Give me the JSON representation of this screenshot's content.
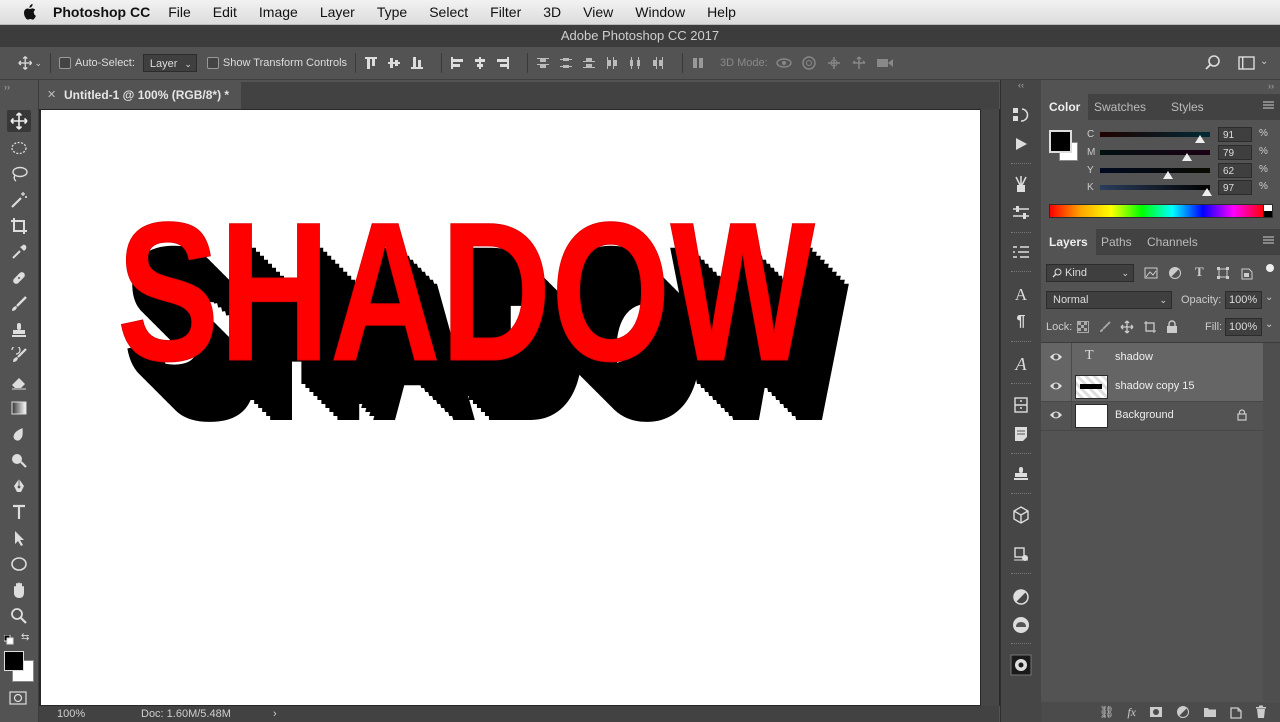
{
  "menubar": {
    "app_name": "Photoshop CC",
    "items": [
      "File",
      "Edit",
      "Image",
      "Layer",
      "Type",
      "Select",
      "Filter",
      "3D",
      "View",
      "Window",
      "Help"
    ]
  },
  "window": {
    "title": "Adobe Photoshop CC 2017"
  },
  "options": {
    "auto_select_label": "Auto-Select:",
    "auto_select_value": "Layer",
    "transform_label": "Show Transform Controls",
    "mode_3d_label": "3D Mode:"
  },
  "document": {
    "tab_title": "Untitled-1 @ 100% (RGB/8*) *",
    "canvas_text": "SHADOW",
    "text_color": "#ff0000",
    "shadow_color": "#000000"
  },
  "status": {
    "zoom": "100%",
    "doc_size": "Doc: 1.60M/5.48M"
  },
  "color_panel": {
    "tabs": [
      "Color",
      "Swatches",
      "Styles"
    ],
    "channels": [
      {
        "label": "C",
        "value": "91",
        "unit": "%",
        "level": 0.91
      },
      {
        "label": "M",
        "value": "79",
        "unit": "%",
        "level": 0.79
      },
      {
        "label": "Y",
        "value": "62",
        "unit": "%",
        "level": 0.62
      },
      {
        "label": "K",
        "value": "97",
        "unit": "%",
        "level": 0.97
      }
    ]
  },
  "layers_panel": {
    "tabs": [
      "Layers",
      "Paths",
      "Channels"
    ],
    "kind_filter": "Kind",
    "blend_mode": "Normal",
    "opacity_label": "Opacity:",
    "opacity_value": "100%",
    "lock_label": "Lock:",
    "fill_label": "Fill:",
    "fill_value": "100%",
    "layers": [
      {
        "name": "shadow",
        "type": "text",
        "selected": true
      },
      {
        "name": "shadow copy 15",
        "type": "pixel",
        "selected": true
      },
      {
        "name": "Background",
        "type": "background",
        "locked": true
      }
    ]
  }
}
